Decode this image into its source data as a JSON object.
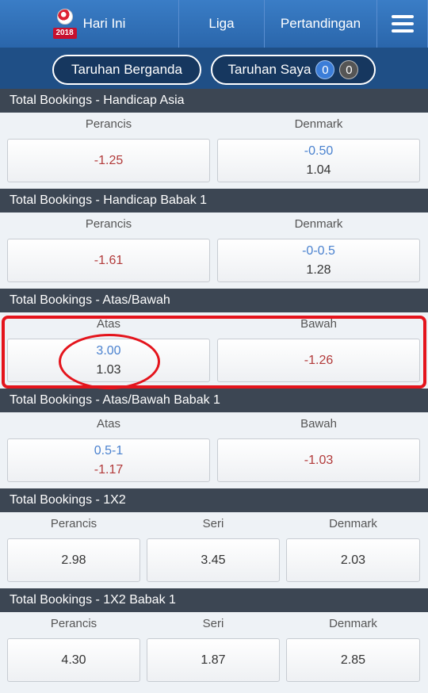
{
  "nav": {
    "logo_year": "2018",
    "today": "Hari Ini",
    "liga": "Liga",
    "match": "Pertandingan"
  },
  "subbar": {
    "multi_bet": "Taruhan Berganda",
    "my_bets": "Taruhan Saya",
    "count_a": "0",
    "count_b": "0"
  },
  "sections": [
    {
      "title": "Total Bookings - Handicap Asia",
      "cols": [
        {
          "label": "Perancis",
          "line": "",
          "price": "-1.25"
        },
        {
          "label": "Denmark",
          "line": "-0.50",
          "price": "1.04"
        }
      ]
    },
    {
      "title": "Total Bookings - Handicap Babak 1",
      "cols": [
        {
          "label": "Perancis",
          "line": "",
          "price": "-1.61"
        },
        {
          "label": "Denmark",
          "line": "-0-0.5",
          "price": "1.28"
        }
      ]
    },
    {
      "title": "Total Bookings - Atas/Bawah",
      "cols": [
        {
          "label": "Atas",
          "line": "3.00",
          "price": "1.03"
        },
        {
          "label": "Bawah",
          "line": "",
          "price": "-1.26"
        }
      ]
    },
    {
      "title": "Total Bookings - Atas/Bawah Babak 1",
      "cols": [
        {
          "label": "Atas",
          "line": "0.5-1",
          "price": "-1.17"
        },
        {
          "label": "Bawah",
          "line": "",
          "price": "-1.03"
        }
      ]
    },
    {
      "title": "Total Bookings - 1X2",
      "cols": [
        {
          "label": "Perancis",
          "line": "",
          "price": "2.98"
        },
        {
          "label": "Seri",
          "line": "",
          "price": "3.45"
        },
        {
          "label": "Denmark",
          "line": "",
          "price": "2.03"
        }
      ]
    },
    {
      "title": "Total Bookings - 1X2 Babak 1",
      "cols": [
        {
          "label": "Perancis",
          "line": "",
          "price": "4.30"
        },
        {
          "label": "Seri",
          "line": "",
          "price": "1.87"
        },
        {
          "label": "Denmark",
          "line": "",
          "price": "2.85"
        }
      ]
    }
  ],
  "colors": {
    "nav_blue": "#2c6db4",
    "section_header": "#3c4653",
    "line_blue": "#4b82cf",
    "negative_red": "#b23a3a",
    "highlight_red": "#e4141c"
  }
}
